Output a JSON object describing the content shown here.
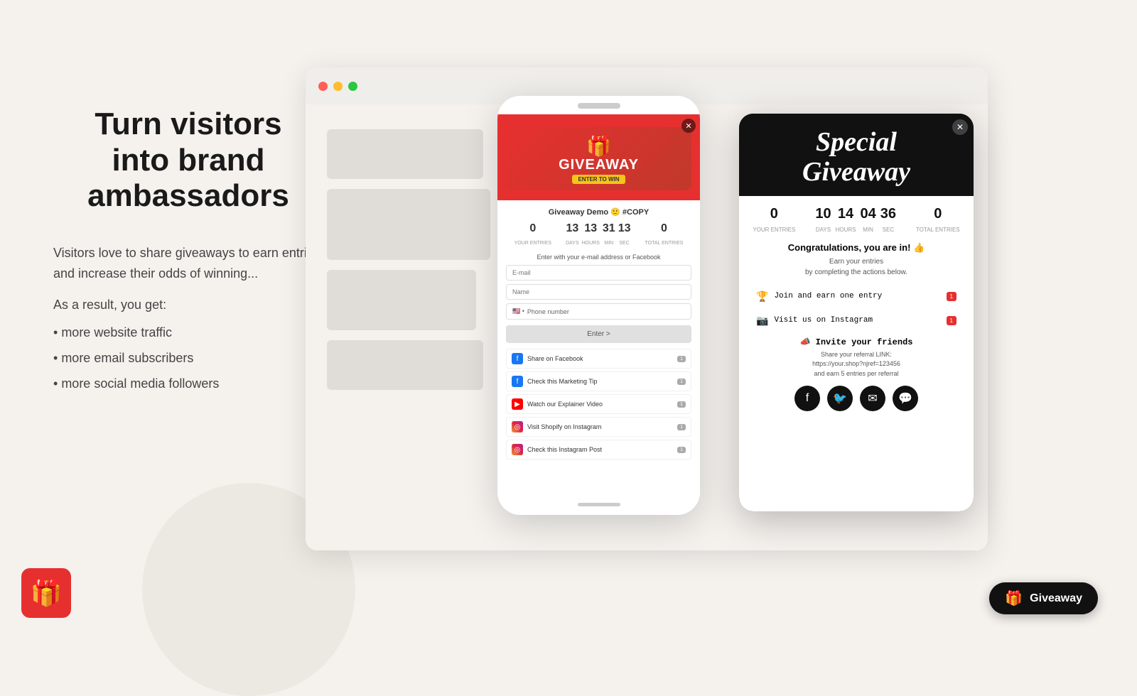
{
  "hero": {
    "heading_line1": "Turn visitors",
    "heading_line2": "into brand",
    "heading_line3": "ambassadors",
    "description": "Visitors love to share giveaways to earn entries and increase their odds of winning...",
    "result_label": "As a result, you get:",
    "bullets": [
      "more website traffic",
      "more email subscribers",
      "more social media followers"
    ]
  },
  "popup1": {
    "title": "GIVEAWAY",
    "subtitle": "ENTER TO WIN",
    "demo_label": "Giveaway Demo 🙂 #COPY",
    "your_entries": "0",
    "your_entries_label": "Your entries",
    "days": "13",
    "hours": "13",
    "min": "31",
    "sec": "13",
    "total_entries": "0",
    "total_entries_label": "Total entries",
    "enter_text": "Enter with your e-mail address or Facebook",
    "email_placeholder": "E-mail",
    "name_placeholder": "Name",
    "phone_placeholder": "Phone number",
    "enter_btn": "Enter >",
    "actions": [
      {
        "icon": "fb",
        "text": "Share on Facebook",
        "badge": "1"
      },
      {
        "icon": "fb",
        "text": "Check this Marketing Tip",
        "badge": "1"
      },
      {
        "icon": "yt",
        "text": "Watch our Explainer Video",
        "badge": "1"
      },
      {
        "icon": "ig",
        "text": "Visit Shopify on Instagram",
        "badge": "1"
      },
      {
        "icon": "ig",
        "text": "Check this Instagram Post",
        "badge": "1"
      }
    ]
  },
  "popup2": {
    "title_line1": "Special",
    "title_line2": "Giveaway",
    "your_entries": "0",
    "your_entries_label": "YOUR ENTRIES",
    "days": "10",
    "hours": "14",
    "min": "04",
    "sec": "36",
    "total_entries": "0",
    "total_entries_label": "Total entries",
    "congrats": "Congratulations, you are in! 👍",
    "earn_text": "Earn your entries\nby completing the actions below.",
    "actions": [
      {
        "icon": "🏆",
        "text": "Join and earn one entry",
        "badge": "1"
      },
      {
        "icon": "📷",
        "text": "Visit us on Instagram",
        "badge": "1"
      }
    ],
    "invite_title": "📣 Invite your friends",
    "invite_text": "Share your referral LINK:\nhttps://your.shop?njref=123456\nand earn 5 entries per referral"
  },
  "giveaway_button": {
    "label": "Giveaway",
    "icon": "🎁"
  },
  "colors": {
    "red": "#e63030",
    "dark": "#111111",
    "bg": "#f5f2ee"
  }
}
